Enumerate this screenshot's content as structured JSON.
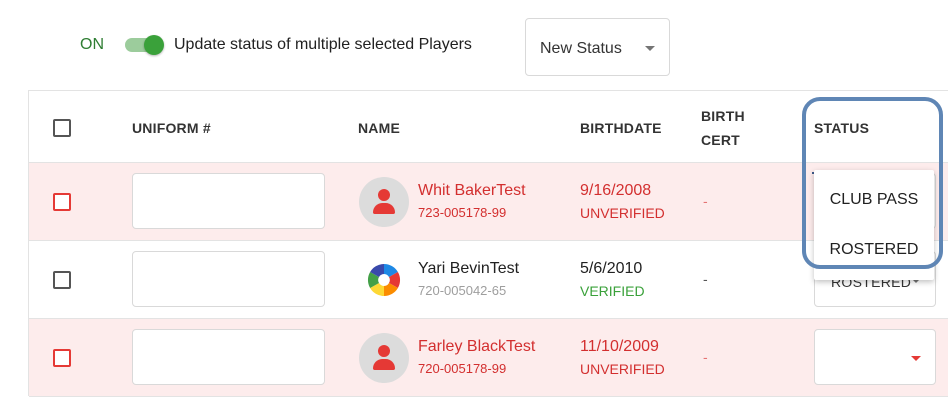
{
  "toolbar": {
    "on_label": "ON",
    "toggle_text": "Update status of multiple selected Players",
    "new_status_label": "New Status"
  },
  "table": {
    "headers": {
      "uniform": "UNIFORM #",
      "name": "NAME",
      "birthdate": "BIRTHDATE",
      "birth_cert_line1": "BIRTH",
      "birth_cert_line2": "CERT",
      "status": "STATUS"
    },
    "rows": [
      {
        "name": "Whit BakerTest",
        "player_id": "723-005178-99",
        "birthdate": "9/16/2008",
        "verification": "UNVERIFIED",
        "birth_cert": "-",
        "status": ""
      },
      {
        "name": "Yari BevinTest",
        "player_id": "720-005042-65",
        "birthdate": "5/6/2010",
        "verification": "VERIFIED",
        "birth_cert": "-",
        "status": "ROSTERED"
      },
      {
        "name": "Farley BlackTest",
        "player_id": "720-005178-99",
        "birthdate": "11/10/2009",
        "verification": "UNVERIFIED",
        "birth_cert": "-",
        "status": ""
      }
    ]
  },
  "status_dropdown": {
    "options": [
      "CLUB PASS",
      "ROSTERED"
    ]
  },
  "colors": {
    "error_row_bg": "#fdecec",
    "error_text": "#d32f2f",
    "verified_text": "#3aa13a",
    "toggle_on": "#3aa13a",
    "highlight_ring": "#5f86b5"
  }
}
